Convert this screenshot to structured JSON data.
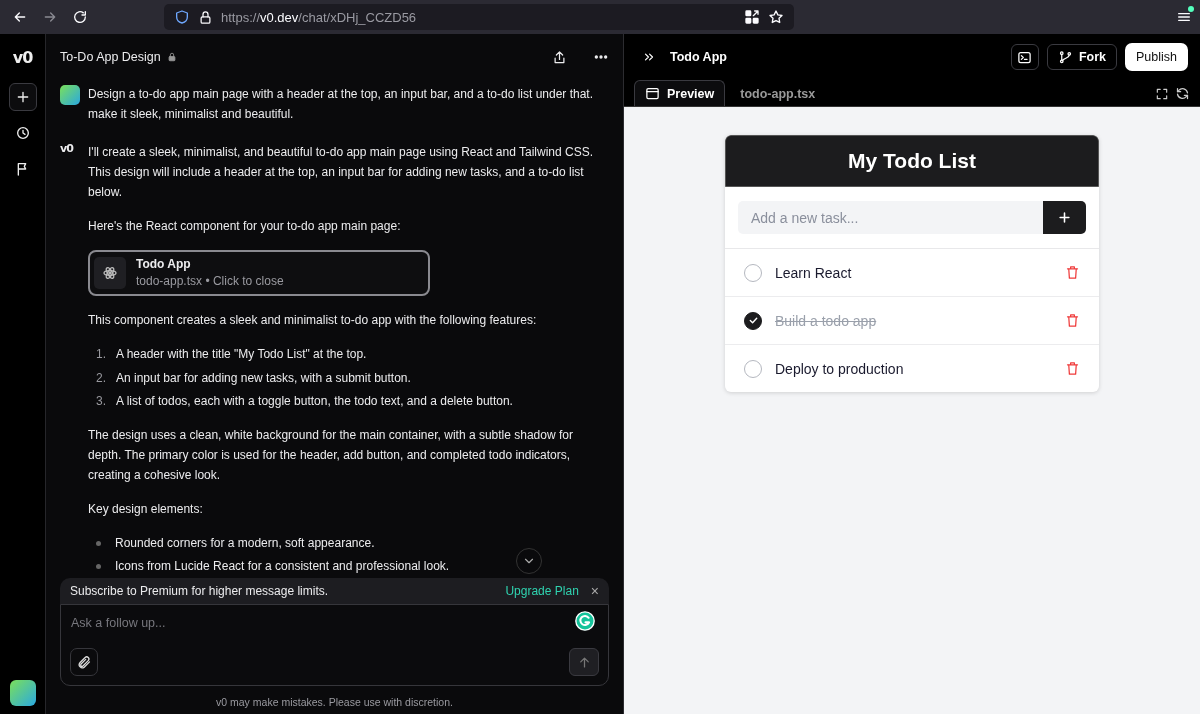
{
  "browser": {
    "url_scheme": "https://",
    "url_host": "v0.dev",
    "url_path": "/chat/xDHj_CCZD56"
  },
  "rail": {
    "logo": "v0"
  },
  "chat": {
    "title": "To-Do App Design",
    "locked": true,
    "user_message": "Design a to-do app main page with a header at the top, an input bar, and a to-do list under that. make it sleek, minimalist and beautiful.",
    "author_mark": "v0",
    "reply": [
      {
        "kind": "paragraph",
        "text": "I'll create a sleek, minimalist, and beautiful to-do app main page using React and Tailwind CSS. This design will include a header at the top, an input bar for adding new tasks, and a to-do list below."
      },
      {
        "kind": "paragraph",
        "text": "Here's the React component for your to-do app main page:"
      },
      {
        "kind": "card",
        "title": "Todo App",
        "subtitle": "todo-app.tsx • Click to close"
      },
      {
        "kind": "paragraph",
        "text": "This component creates a sleek and minimalist to-do app with the following features:"
      },
      {
        "kind": "ordered_list",
        "items": [
          {
            "number": "1.",
            "text": "A header with the title \"My Todo List\" at the top."
          },
          {
            "number": "2.",
            "text": "An input bar for adding new tasks, with a submit button."
          },
          {
            "number": "3.",
            "text": "A list of todos, each with a toggle button, the todo text, and a delete button."
          }
        ]
      },
      {
        "kind": "paragraph",
        "text": "The design uses a clean, white background for the main container, with a subtle shadow for depth. The primary color is used for the header, add button, and completed todo indicators, creating a cohesive look."
      },
      {
        "kind": "paragraph",
        "text": "Key design elements:"
      },
      {
        "kind": "bullet_list",
        "items": [
          {
            "text": "Rounded corners for a modern, soft appearance."
          },
          {
            "text": "Icons from Lucide React for a consistent and professional look."
          }
        ]
      }
    ],
    "banner": {
      "text": "Subscribe to Premium for higher message limits.",
      "link": "Upgrade Plan",
      "close": "×"
    },
    "composer": {
      "placeholder": "Ask a follow up..."
    },
    "disclaimer": "v0 may make mistakes. Please use with discretion."
  },
  "preview": {
    "title": "Todo App",
    "fork": "Fork",
    "publish": "Publish",
    "tabs": [
      {
        "label": "Preview",
        "selected": true
      },
      {
        "label": "todo-app.tsx",
        "selected": false
      }
    ],
    "app": {
      "title": "My Todo List",
      "input_placeholder": "Add a new task...",
      "todos": [
        {
          "text": "Learn React",
          "done": false
        },
        {
          "text": "Build a todo app",
          "done": true
        },
        {
          "text": "Deploy to production",
          "done": false
        }
      ]
    }
  }
}
